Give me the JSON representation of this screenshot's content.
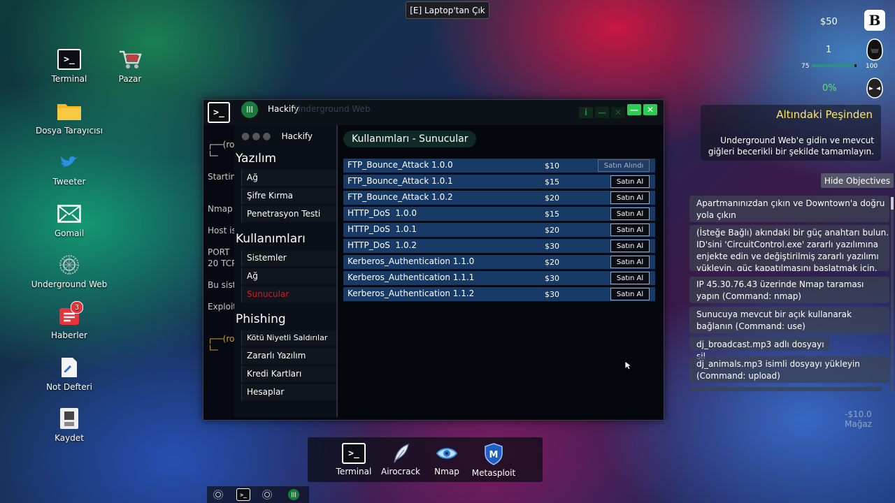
{
  "top_hint": "[E] Laptop'tan Çık",
  "desktop_icons": [
    {
      "label": "Terminal",
      "icon": "terminal-icon"
    },
    {
      "label": "Pazar",
      "icon": "cart-icon"
    },
    {
      "label": "Dosya Tarayıcısı",
      "icon": "folder-icon"
    },
    {
      "label": "Tweeter",
      "icon": "bird-icon"
    },
    {
      "label": "Gomail",
      "icon": "mail-icon"
    },
    {
      "label": "Underground Web",
      "icon": "web-emblem-icon"
    },
    {
      "label": "Haberler",
      "icon": "news-icon",
      "badge": "3"
    },
    {
      "label": "Not Defteri",
      "icon": "notepad-icon"
    },
    {
      "label": "Kaydet",
      "icon": "save-icon"
    }
  ],
  "window": {
    "title": "Hackify",
    "title_ghost": "Underground Web",
    "bg_terminal_lines": [
      "┌──(ro",
      "└─",
      "Startin",
      "Nmap s",
      "Host is",
      "PORT",
      "20 TCP",
      "Bu siste",
      "Exploit",
      "┌──(ro",
      "└─"
    ],
    "sidebar": {
      "app_name": "Hackify",
      "sections": [
        {
          "title": "Yazılım",
          "items": [
            "Ağ",
            "Şifre Kırma",
            "Penetrasyon Testi"
          ]
        },
        {
          "title": "Kullanımları",
          "items": [
            "Sistemler",
            "Ağ",
            "Sunucular"
          ]
        },
        {
          "title": "Phishing",
          "items": [
            "Kötü Niyetli Saldırılar",
            "Zararlı Yazılım",
            "Kredi Kartları",
            "Hesaplar"
          ]
        }
      ]
    },
    "content": {
      "heading": "Kullanımları - Sunucular",
      "rows": [
        {
          "name": "FTP_Bounce_Attack 1.0.0",
          "price": "$10",
          "button": "Satın Alındı",
          "bought": true
        },
        {
          "name": "FTP_Bounce_Attack 1.0.1",
          "price": "$15",
          "button": "Satın Al",
          "bought": false
        },
        {
          "name": "FTP_Bounce_Attack 1.0.2",
          "price": "$20",
          "button": "Satın Al",
          "bought": false
        },
        {
          "name": "HTTP_DoS  1.0.0",
          "price": "$15",
          "button": "Satın Al",
          "bought": false
        },
        {
          "name": "HTTP_DoS  1.0.1",
          "price": "$20",
          "button": "Satın Al",
          "bought": false
        },
        {
          "name": "HTTP_DoS  1.0.2",
          "price": "$30",
          "button": "Satın Al",
          "bought": false
        },
        {
          "name": "Kerberos_Authentication 1.1.0",
          "price": "$20",
          "button": "Satın Al",
          "bought": false
        },
        {
          "name": "Kerberos_Authentication 1.1.1",
          "price": "$30",
          "button": "Satın Al",
          "bought": false
        },
        {
          "name": "Kerberos_Authentication 1.1.2",
          "price": "$30",
          "button": "Satın Al",
          "bought": false
        }
      ]
    }
  },
  "hud": {
    "money": "$50",
    "level": "1",
    "xp_min": "75",
    "xp_max": "100",
    "xp_progress": 0.95,
    "percent": "0%"
  },
  "objectives": {
    "title": "Altındaki Peşinden",
    "description": "Underground Web'e gidin ve mevcut giğleri becerikli bir şekilde tamamlayın.",
    "hide_button": "Hide Objectives",
    "items": [
      "Apartmanınızdan çıkın ve Downtown'a doğru yola çıkın",
      "(İsteğe Bağlı) akındaki bir güç anahtarı bulun. ID'sini 'CircuitControl.exe' zararlı yazılımına enjekte edin ve değiştirilmiş zararlı yazılımı yükleyin, güç kapatılmasını başlatmak için. (Command: inject)",
      "IP 45.30.76.43 üzerinde Nmap taraması yapın (Command: nmap)",
      "Sunucuya mevcut bir açık kullanarak bağlanın (Command: use)",
      "dj_broadcast.mp3 adlı dosyayı sil",
      "dj_animals.mp3 isimli dosyayı yükleyin (Command: upload)"
    ],
    "store_notice": "-$10.0 Mağaz"
  },
  "dock": [
    {
      "label": "Terminal",
      "icon": "terminal-icon"
    },
    {
      "label": "Airocrack",
      "icon": "feather-icon"
    },
    {
      "label": "Nmap",
      "icon": "eye-icon"
    },
    {
      "label": "Metasploit",
      "icon": "shield-m-icon"
    }
  ],
  "colors": {
    "accent_green": "#2ecc55",
    "active_red": "#c0222a",
    "row_blue": "#183a66"
  }
}
